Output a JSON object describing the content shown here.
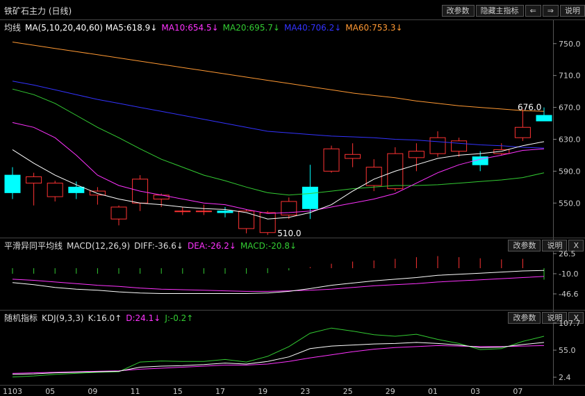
{
  "title": "铁矿石主力 (日线)",
  "toolbar": {
    "params": "改参数",
    "hide": "隐藏主指标",
    "prev": "⇐",
    "next": "⇒",
    "help": "说明"
  },
  "ma": {
    "label": "均线",
    "ma5": "MA(5,10,20,40,60)  MA5:618.9↓",
    "ma10": "MA10:654.5↓",
    "ma20": "MA20:695.7↓",
    "ma40": "MA40:706.2↓",
    "ma60": "MA60:753.3↓"
  },
  "colors": {
    "up": "#ff3333",
    "down": "#00ffff",
    "ma5": "#ffffff",
    "ma10": "#ff33ff",
    "ma20": "#33cc33",
    "ma40": "#3333ff",
    "ma60": "#ff9933"
  },
  "macd": {
    "label": "平滑异同平均线",
    "params": "MACD(12,26,9)",
    "diff": "DIFF:-36.6↓",
    "dea": "DEA:-26.2↓",
    "macd": "MACD:-20.8↓",
    "btn_params": "改参数",
    "btn_help": "说明",
    "btn_close": "X"
  },
  "kdj": {
    "label": "随机指标",
    "params": "KDJ(9,3,3)",
    "k": "K:16.0↑",
    "d": "D:24.1↓",
    "j": "J:-0.2↑",
    "btn_params": "改参数",
    "btn_help": "说明",
    "btn_close": "X"
  },
  "price_ticks": [
    "750.0",
    "710.0",
    "670.0",
    "630.0",
    "590.0",
    "550.0"
  ],
  "macd_ticks": [
    "26.5",
    "-10.0",
    "-46.6"
  ],
  "kdj_ticks": [
    "107.7",
    "55.0",
    "2.4"
  ],
  "date_ticks": [
    "1103",
    "05",
    "09",
    "11",
    "15",
    "17",
    "19",
    "23",
    "25",
    "29",
    "01",
    "03",
    "07"
  ],
  "annotations": {
    "high": "676.0",
    "low": "510.0"
  },
  "chart_data": {
    "type": "candlestick",
    "ylim": [
      518,
      762
    ],
    "candles": [
      [
        585,
        563,
        595,
        555
      ],
      [
        575,
        583,
        588,
        547
      ],
      [
        558,
        575,
        578,
        552
      ],
      [
        570,
        563,
        577,
        555
      ],
      [
        560,
        565,
        570,
        548
      ],
      [
        530,
        545,
        547,
        522
      ],
      [
        550,
        580,
        585,
        540
      ],
      [
        555,
        560,
        562,
        545
      ],
      [
        540,
        540,
        545,
        535
      ],
      [
        540,
        540,
        548,
        535
      ],
      [
        540,
        538,
        545,
        532
      ],
      [
        518,
        540,
        542,
        512
      ],
      [
        513,
        538,
        540,
        510
      ],
      [
        535,
        552,
        557,
        530
      ],
      [
        570,
        543,
        598,
        530
      ],
      [
        590,
        618,
        622,
        588
      ],
      [
        606,
        611,
        625,
        595
      ],
      [
        572,
        595,
        605,
        565
      ],
      [
        568,
        612,
        620,
        565
      ],
      [
        607,
        615,
        625,
        590
      ],
      [
        612,
        632,
        640,
        608
      ],
      [
        615,
        628,
        632,
        608
      ],
      [
        608,
        598,
        615,
        590
      ],
      [
        612,
        617,
        625,
        610
      ],
      [
        632,
        645,
        668,
        628
      ],
      [
        660,
        653,
        670,
        655
      ]
    ],
    "ma5": [
      617,
      600,
      585,
      573,
      562,
      555,
      550,
      548,
      545,
      543,
      542,
      538,
      530,
      532,
      538,
      548,
      565,
      580,
      590,
      598,
      606,
      610,
      612,
      615,
      622,
      627
    ],
    "ma10": [
      651,
      645,
      632,
      610,
      585,
      572,
      565,
      560,
      555,
      550,
      548,
      542,
      537,
      538,
      540,
      545,
      550,
      555,
      562,
      575,
      588,
      598,
      605,
      610,
      616,
      618
    ],
    "ma20": [
      693,
      686,
      675,
      660,
      645,
      632,
      618,
      605,
      595,
      585,
      578,
      570,
      563,
      560,
      562,
      565,
      568,
      570,
      572,
      572,
      573,
      575,
      577,
      579,
      582,
      588
    ],
    "ma40": [
      703,
      698,
      692,
      686,
      680,
      675,
      670,
      665,
      660,
      655,
      650,
      645,
      640,
      638,
      636,
      634,
      633,
      632,
      630,
      629,
      627,
      625,
      623,
      622,
      620,
      619
    ],
    "ma60": [
      752,
      748,
      744,
      740,
      736,
      732,
      728,
      724,
      720,
      716,
      712,
      708,
      704,
      700,
      696,
      692,
      688,
      685,
      682,
      678,
      675,
      672,
      670,
      668,
      666,
      665
    ],
    "macd_hist": [
      -10,
      -10,
      -10,
      -10,
      -10,
      -10,
      -10,
      -10,
      -10,
      -10,
      -10,
      -10,
      -9,
      -4,
      2,
      8,
      12,
      14,
      17,
      20,
      22,
      20,
      18,
      16,
      17,
      -20.8
    ],
    "diff": [
      -26,
      -30,
      -35,
      -38,
      -40,
      -43,
      -45,
      -46,
      -46,
      -46,
      -46,
      -46,
      -45,
      -42,
      -37,
      -31,
      -27,
      -23,
      -20,
      -17,
      -13,
      -11,
      -9,
      -7,
      -5,
      -4
    ],
    "dea": [
      -20,
      -22,
      -25,
      -28,
      -31,
      -33,
      -36,
      -38,
      -39,
      -40,
      -41,
      -42,
      -42,
      -41,
      -40,
      -38,
      -35,
      -32,
      -30,
      -28,
      -25,
      -23,
      -21,
      -19,
      -17,
      -15
    ],
    "k": [
      8,
      9,
      11,
      12,
      13,
      14,
      22,
      24,
      25,
      27,
      30,
      28,
      33,
      42,
      58,
      63,
      65,
      67,
      68,
      70,
      68,
      65,
      60,
      61,
      66,
      70
    ],
    "d": [
      10,
      11,
      12,
      13,
      14,
      15,
      18,
      20,
      22,
      24,
      26,
      26,
      28,
      33,
      40,
      46,
      52,
      57,
      60,
      62,
      64,
      63,
      62,
      62,
      63,
      64
    ],
    "j": [
      3,
      5,
      8,
      10,
      12,
      13,
      32,
      34,
      33,
      33,
      37,
      32,
      43,
      62,
      88,
      98,
      92,
      85,
      82,
      86,
      76,
      68,
      56,
      58,
      72,
      82
    ]
  }
}
